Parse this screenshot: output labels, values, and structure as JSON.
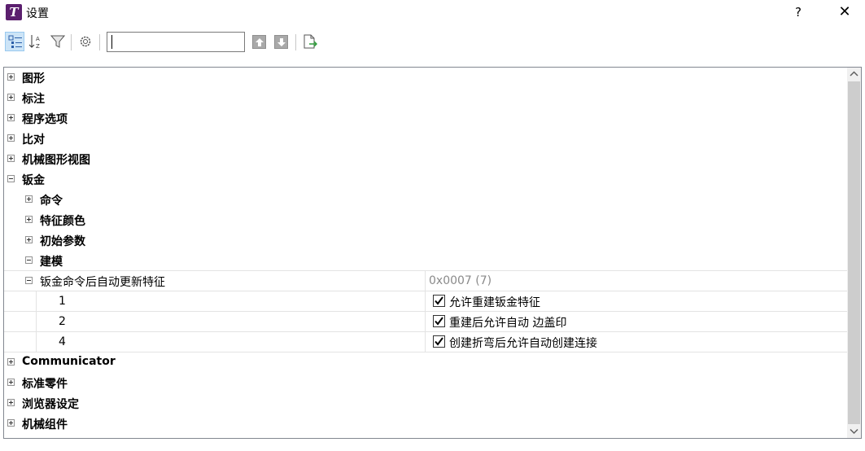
{
  "window": {
    "app_icon_letter": "T",
    "title": "设置",
    "help_label": "?",
    "close_label": "✕"
  },
  "toolbar": {
    "search_value": "",
    "icons": [
      "categorized-view-icon",
      "sort-alphabetical-icon",
      "filter-icon",
      "settings-gear-icon",
      "move-up-icon",
      "move-down-icon",
      "export-icon"
    ]
  },
  "tree": {
    "top_items": [
      {
        "label": "图形",
        "state": "collapsed"
      },
      {
        "label": "标注",
        "state": "collapsed"
      },
      {
        "label": "程序选项",
        "state": "collapsed"
      },
      {
        "label": "比对",
        "state": "collapsed"
      },
      {
        "label": "机械图形视图",
        "state": "collapsed"
      },
      {
        "label": "钣金",
        "state": "expanded"
      }
    ],
    "sheetmetal_children": [
      {
        "label": "命令",
        "state": "collapsed"
      },
      {
        "label": "特征颜色",
        "state": "collapsed"
      },
      {
        "label": "初始参数",
        "state": "collapsed"
      },
      {
        "label": "建模",
        "state": "expanded"
      }
    ],
    "property": {
      "label": "钣金命令后自动更新特征",
      "value": "0x0007 (7)",
      "flags": [
        {
          "index": "1",
          "checked": true,
          "label": "允许重建钣金特征"
        },
        {
          "index": "2",
          "checked": true,
          "label": "重建后允许自动 边盖印"
        },
        {
          "index": "4",
          "checked": true,
          "label": "创建折弯后允许自动创建连接"
        }
      ]
    },
    "bottom_items": [
      {
        "label": "Communicator",
        "state": "collapsed"
      },
      {
        "label": "标准零件",
        "state": "collapsed"
      },
      {
        "label": "浏览器设定",
        "state": "collapsed"
      },
      {
        "label": "机械组件",
        "state": "collapsed"
      }
    ]
  },
  "scrollbar": {
    "up": "^",
    "down": "v"
  }
}
